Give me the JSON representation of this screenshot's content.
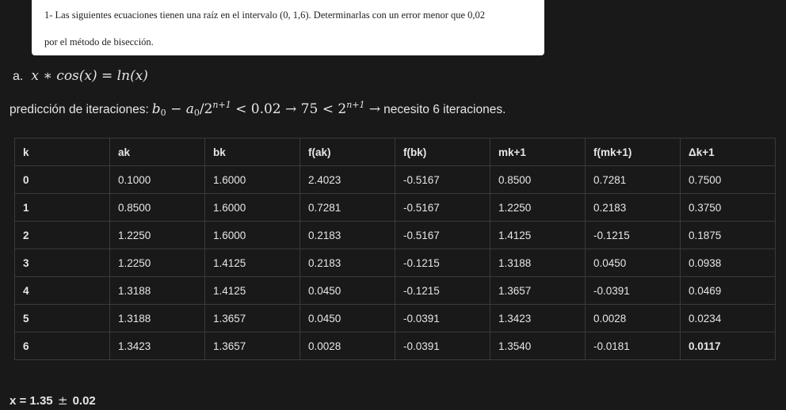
{
  "problem": {
    "line1": "1-  Las siguientes ecuaciones tienen una raíz en el intervalo (0, 1,6). Determinarlas con un error menor que 0,02",
    "line2": "por el método de bisección."
  },
  "item_a": {
    "label": "a.",
    "equation": "x ∗ cos(x) = ln(x)"
  },
  "prediction": {
    "prefix": "predicción de iteraciones:",
    "inequality_left": "b",
    "sub0": "0",
    "minus": " − a",
    "sub0b": "0",
    "over": "/2",
    "exp1": "n+1",
    "lt1": " < 0.02 → 75 < 2",
    "exp2": "n+1",
    "arrow": " →",
    "suffix": "necesito 6 iteraciones."
  },
  "table": {
    "headers": [
      "k",
      "ak",
      "bk",
      "f(ak)",
      "f(bk)",
      "mk+1",
      "f(mk+1)",
      "Δk+1"
    ],
    "rows": [
      [
        "0",
        "0.1000",
        "1.6000",
        "2.4023",
        "-0.5167",
        "0.8500",
        "0.7281",
        "0.7500"
      ],
      [
        "1",
        "0.8500",
        "1.6000",
        "0.7281",
        "-0.5167",
        "1.2250",
        "0.2183",
        "0.3750"
      ],
      [
        "2",
        "1.2250",
        "1.6000",
        "0.2183",
        "-0.5167",
        "1.4125",
        "-0.1215",
        "0.1875"
      ],
      [
        "3",
        "1.2250",
        "1.4125",
        "0.2183",
        "-0.1215",
        "1.3188",
        "0.0450",
        "0.0938"
      ],
      [
        "4",
        "1.3188",
        "1.4125",
        "0.0450",
        "-0.1215",
        "1.3657",
        "-0.0391",
        "0.0469"
      ],
      [
        "5",
        "1.3188",
        "1.3657",
        "0.0450",
        "-0.0391",
        "1.3423",
        "0.0028",
        "0.0234"
      ],
      [
        "6",
        "1.3423",
        "1.3657",
        "0.0028",
        "-0.0391",
        "1.3540",
        "-0.0181",
        "0.0117"
      ]
    ]
  },
  "result": {
    "prefix": "x = 1.35",
    "pm": "±",
    "suffix": "0.02"
  }
}
